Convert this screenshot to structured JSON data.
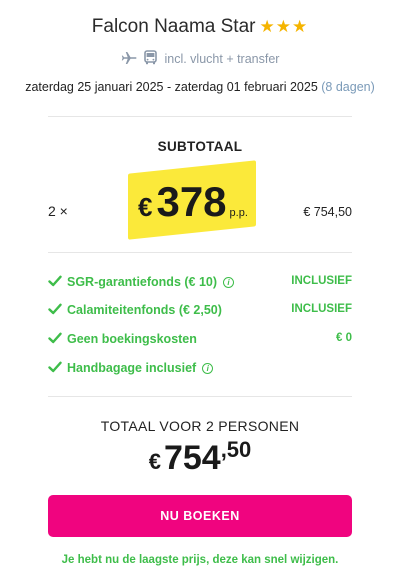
{
  "header": {
    "hotel_name": "Falcon Naama Star",
    "stars": "★★★",
    "transport_text": "incl. vlucht + transfer",
    "date_range": "zaterdag 25 januari 2025 - zaterdag 01 februari 2025",
    "duration": "(8 dagen)"
  },
  "subtotal": {
    "label": "SUBTOTAAL",
    "quantity": "2 ×",
    "currency": "€",
    "price_per_person": "378",
    "per_person_label": "p.p.",
    "line_total": "€ 754,50"
  },
  "inclusions": [
    {
      "label": "SGR-garantiefonds",
      "amount": "(€ 10)",
      "info": "i",
      "value": "INCLUSIEF"
    },
    {
      "label": "Calamiteitenfonds",
      "amount": "(€ 2,50)",
      "info": "",
      "value": "INCLUSIEF"
    },
    {
      "label": "Geen boekingskosten",
      "amount": "",
      "info": "",
      "value": "€ 0"
    },
    {
      "label": "Handbagage inclusief",
      "amount": "",
      "info": "i",
      "value": ""
    }
  ],
  "total": {
    "label": "TOTAAL VOOR 2 PERSONEN",
    "currency": "€",
    "integer": "754",
    "decimal": ",50"
  },
  "cta": {
    "book_label": "NU BOEKEN"
  },
  "note": "Je hebt nu de laagste prijs, deze kan snel wijzigen.",
  "colors": {
    "accent_pink": "#f0047f",
    "success_green": "#3ebd4a",
    "highlight_yellow": "#fbe93a",
    "star_gold": "#f5b400"
  },
  "icons": [
    "plane-icon",
    "bus-icon",
    "checkmark-icon",
    "info-icon"
  ]
}
